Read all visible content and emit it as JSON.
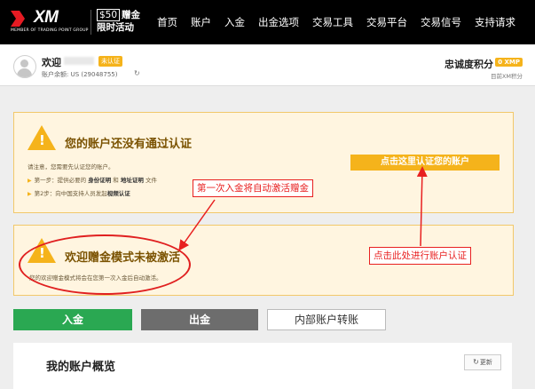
{
  "header": {
    "logo_text": "XM",
    "logo_subtitle": "MEMBER OF TRADING POINT GROUP",
    "promo_amount": "$50",
    "promo_line1": "赠金",
    "promo_line2": "限时活动",
    "nav": [
      "首页",
      "账户",
      "入金",
      "出金选项",
      "交易工具",
      "交易平台",
      "交易信号",
      "支持请求"
    ]
  },
  "profile": {
    "welcome": "欢迎",
    "unverified_badge": "未认证",
    "balance": "账户余额: US  (29048755)",
    "loyalty_title": "忠诚度积分",
    "loyalty_badge": "0 XMP",
    "loyalty_status": "目前XM积分"
  },
  "verify_panel": {
    "title": "您的账户还没有通过认证",
    "note": "请注意，您需要先认证您的账户。",
    "step1_label": "第一步：",
    "step1_text": "提供必要的",
    "step1_doc1": "身份证明",
    "step1_and": "和",
    "step1_doc2": "地址证明",
    "step1_end": "文件",
    "step2_label": "第2步：",
    "step2_text": "向中国支持人员发起",
    "step2_call": "视频认证",
    "button": "点击这里认证您的账户"
  },
  "bonus_panel": {
    "title": "欢迎赠金模式未被激活",
    "text": "您的欢迎赠金模式将会在您第一次入金后自动激活。"
  },
  "annotations": {
    "first_deposit": "第一次入金将自动激活赠金",
    "verify_here": "点击此处进行账户认证"
  },
  "actions": {
    "deposit": "入金",
    "withdraw": "出金",
    "transfer": "内部账户转账"
  },
  "overview": {
    "title": "我的账户概览",
    "refresh": "更新"
  },
  "colors": {
    "nav_bg": "#000000",
    "accent_orange": "#f5b31b",
    "deposit_green": "#2aa852",
    "withdraw_gray": "#6d6d6d",
    "annotation_red": "#e82020"
  }
}
